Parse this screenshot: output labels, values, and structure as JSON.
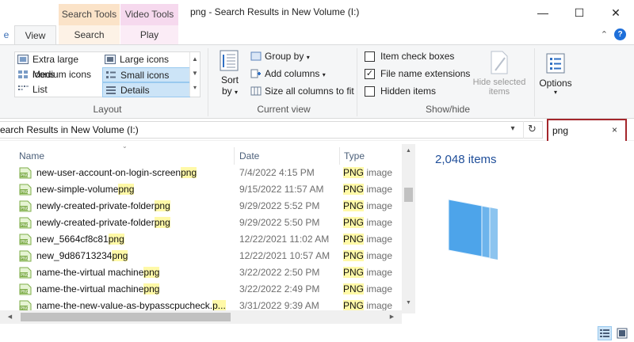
{
  "window": {
    "title": "png - Search Results in New Volume (I:)",
    "minimize": "—",
    "maximize": "☐",
    "close": "✕"
  },
  "ribbon": {
    "contextual_tabs": [
      "Search Tools",
      "Video Tools"
    ],
    "tabs": [
      "View",
      "Search",
      "Play"
    ],
    "layout": {
      "items": [
        "Extra large icons",
        "Large icons",
        "Medium icons",
        "Small icons",
        "List",
        "Details"
      ],
      "selected": "Details",
      "label": "Layout"
    },
    "current_view": {
      "sort_by": "Sort",
      "sort_by_2": "by",
      "group_by": "Group by",
      "add_columns": "Add columns",
      "size_columns": "Size all columns to fit",
      "label": "Current view"
    },
    "show_hide": {
      "item_check_boxes": "Item check boxes",
      "file_name_extensions": "File name extensions",
      "hidden_items": "Hidden items",
      "hide_selected_1": "Hide selected",
      "hide_selected_2": "items",
      "label": "Show/hide",
      "checked": {
        "item_check_boxes": false,
        "file_name_extensions": true,
        "hidden_items": false
      }
    },
    "options": "Options"
  },
  "address": {
    "path": "earch Results in New Volume (I:)"
  },
  "search": {
    "value": "png",
    "clear": "×"
  },
  "columns": {
    "name": "Name",
    "date": "Date",
    "type": "Type"
  },
  "files": [
    {
      "base": "new-user-account-on-login-screen",
      "ext": "png",
      "date": "7/4/2022 4:15 PM",
      "type_hl": "PNG",
      "type_rest": " image"
    },
    {
      "base": "new-simple-volume",
      "ext": "png",
      "date": "9/15/2022 11:57 AM",
      "type_hl": "PNG",
      "type_rest": " image"
    },
    {
      "base": "newly-created-private-folder",
      "ext": "png",
      "date": "9/29/2022 5:52 PM",
      "type_hl": "PNG",
      "type_rest": " image"
    },
    {
      "base": "newly-created-private-folder",
      "ext": "png",
      "date": "9/29/2022 5:50 PM",
      "type_hl": "PNG",
      "type_rest": " image"
    },
    {
      "base": "new_5664cf8c81",
      "ext": "png",
      "date": "12/22/2021 11:02 AM",
      "type_hl": "PNG",
      "type_rest": " image"
    },
    {
      "base": "new_9d86713234",
      "ext": "png",
      "date": "12/22/2021 10:57 AM",
      "type_hl": "PNG",
      "type_rest": " image"
    },
    {
      "base": "name-the-virtual machine",
      "ext": "png",
      "date": "3/22/2022 2:50 PM",
      "type_hl": "PNG",
      "type_rest": " image"
    },
    {
      "base": "name-the-virtual machine",
      "ext": "png",
      "date": "3/22/2022 2:49 PM",
      "type_hl": "PNG",
      "type_rest": " image"
    },
    {
      "base": "name-the-new-value-as-bypasscpucheck.",
      "ext": "p...",
      "date": "3/31/2022 9:39 AM",
      "type_hl": "PNG",
      "type_rest": " image"
    }
  ],
  "details_pane": {
    "item_count": "2,048 items"
  },
  "icons": {
    "file": "png-file-icon",
    "stack": "file-stack-icon"
  }
}
